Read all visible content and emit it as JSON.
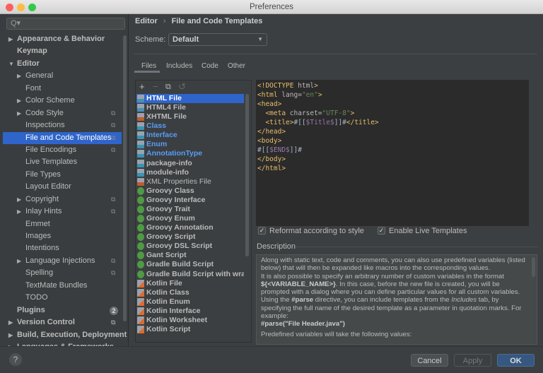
{
  "window": {
    "title": "Preferences"
  },
  "sidebar": {
    "search_placeholder": "Q▾",
    "items": [
      {
        "label": "Appearance & Behavior",
        "level": 0,
        "arrow": "▶",
        "bold": true
      },
      {
        "label": "Keymap",
        "level": 0,
        "bold": true
      },
      {
        "label": "Editor",
        "level": 0,
        "arrow": "▼",
        "bold": true
      },
      {
        "label": "General",
        "level": 1,
        "arrow": "▶"
      },
      {
        "label": "Font",
        "level": 1
      },
      {
        "label": "Color Scheme",
        "level": 1,
        "arrow": "▶"
      },
      {
        "label": "Code Style",
        "level": 1,
        "arrow": "▶",
        "copy": true
      },
      {
        "label": "Inspections",
        "level": 1,
        "copy": true
      },
      {
        "label": "File and Code Templates",
        "level": 1,
        "copy": true,
        "selected": true
      },
      {
        "label": "File Encodings",
        "level": 1,
        "copy": true
      },
      {
        "label": "Live Templates",
        "level": 1
      },
      {
        "label": "File Types",
        "level": 1
      },
      {
        "label": "Layout Editor",
        "level": 1
      },
      {
        "label": "Copyright",
        "level": 1,
        "arrow": "▶",
        "copy": true
      },
      {
        "label": "Inlay Hints",
        "level": 1,
        "arrow": "▶",
        "copy": true
      },
      {
        "label": "Emmet",
        "level": 1
      },
      {
        "label": "Images",
        "level": 1
      },
      {
        "label": "Intentions",
        "level": 1
      },
      {
        "label": "Language Injections",
        "level": 1,
        "arrow": "▶",
        "copy": true
      },
      {
        "label": "Spelling",
        "level": 1,
        "copy": true
      },
      {
        "label": "TextMate Bundles",
        "level": 1
      },
      {
        "label": "TODO",
        "level": 1
      },
      {
        "label": "Plugins",
        "level": 0,
        "bold": true,
        "badge": "2"
      },
      {
        "label": "Version Control",
        "level": 0,
        "arrow": "▶",
        "bold": true,
        "copy": true
      },
      {
        "label": "Build, Execution, Deployment",
        "level": 0,
        "arrow": "▶",
        "bold": true
      },
      {
        "label": "Languages & Frameworks",
        "level": 0,
        "arrow": "▶",
        "bold": true
      }
    ]
  },
  "header": {
    "breadcrumb_parent": "Editor",
    "breadcrumb_sep": "›",
    "breadcrumb_current": "File and Code Templates",
    "scheme_label": "Scheme:",
    "scheme_value": "Default"
  },
  "tabs": [
    {
      "label": "Files",
      "active": true
    },
    {
      "label": "Includes"
    },
    {
      "label": "Code"
    },
    {
      "label": "Other"
    }
  ],
  "toolbar": {
    "add": "+",
    "remove": "−",
    "copy": "⧉",
    "reset": "↺"
  },
  "templates": [
    {
      "label": "HTML File",
      "icon": "html",
      "selected": true
    },
    {
      "label": "HTML4 File",
      "icon": "html"
    },
    {
      "label": "XHTML File",
      "icon": "xhtml"
    },
    {
      "label": "Class",
      "icon": "java",
      "style": "blue"
    },
    {
      "label": "Interface",
      "icon": "java",
      "style": "blue"
    },
    {
      "label": "Enum",
      "icon": "java",
      "style": "blue"
    },
    {
      "label": "AnnotationType",
      "icon": "java",
      "style": "blue"
    },
    {
      "label": "package-info",
      "icon": "java"
    },
    {
      "label": "module-info",
      "icon": "java"
    },
    {
      "label": "XML Properties File",
      "icon": "xml",
      "style": "norm"
    },
    {
      "label": "Groovy Class",
      "icon": "groovy"
    },
    {
      "label": "Groovy Interface",
      "icon": "groovy"
    },
    {
      "label": "Groovy Trait",
      "icon": "groovy"
    },
    {
      "label": "Groovy Enum",
      "icon": "groovy"
    },
    {
      "label": "Groovy Annotation",
      "icon": "groovy"
    },
    {
      "label": "Groovy Script",
      "icon": "groovy"
    },
    {
      "label": "Groovy DSL Script",
      "icon": "groovy"
    },
    {
      "label": "Gant Script",
      "icon": "groovy"
    },
    {
      "label": "Gradle Build Script",
      "icon": "groovy"
    },
    {
      "label": "Gradle Build Script with wrap",
      "icon": "groovy"
    },
    {
      "label": "Kotlin File",
      "icon": "kotlin"
    },
    {
      "label": "Kotlin Class",
      "icon": "kotlin"
    },
    {
      "label": "Kotlin Enum",
      "icon": "kotlin"
    },
    {
      "label": "Kotlin Interface",
      "icon": "kotlin"
    },
    {
      "label": "Kotlin Worksheet",
      "icon": "kotlin"
    },
    {
      "label": "Kotlin Script",
      "icon": "kotlin"
    }
  ],
  "code_lines": [
    [
      [
        "t",
        "<!DOCTYPE "
      ],
      [
        "a",
        "html"
      ],
      [
        "t",
        ">"
      ]
    ],
    [
      [
        "t",
        "<html "
      ],
      [
        "a",
        "lang="
      ],
      [
        "s",
        "\"en\""
      ],
      [
        "t",
        ">"
      ]
    ],
    [
      [
        "t",
        "<head>"
      ]
    ],
    [
      [
        "p",
        "  "
      ],
      [
        "t",
        "<meta "
      ],
      [
        "a",
        "charset="
      ],
      [
        "s",
        "\"UTF-8\""
      ],
      [
        "t",
        ">"
      ]
    ],
    [
      [
        "p",
        "  "
      ],
      [
        "t",
        "<title>"
      ],
      [
        "p",
        "#[["
      ],
      [
        "v",
        "$Title$"
      ],
      [
        "p",
        "]]#"
      ],
      [
        "t",
        "</title>"
      ]
    ],
    [
      [
        "t",
        "</head>"
      ]
    ],
    [
      [
        "t",
        "<body>"
      ]
    ],
    [
      [
        "p",
        "#[["
      ],
      [
        "v",
        "$END$"
      ],
      [
        "p",
        "]]#"
      ]
    ],
    [
      [
        "t",
        "</body>"
      ]
    ],
    [
      [
        "t",
        "</html>"
      ]
    ]
  ],
  "options": {
    "reformat": "Reformat according to style",
    "reformat_checked": true,
    "live": "Enable Live Templates",
    "live_checked": true,
    "check_glyph": "✓"
  },
  "description": {
    "label": "Description",
    "p1": "Along with static text, code and comments, you can also use predefined variables (listed below) that will then be expanded like macros into the corresponding values.",
    "p2a": "It is also possible to specify an arbitrary number of custom variables in the format ",
    "p2b": "${<VARIABLE_NAME>}",
    "p2c": ". In this case, before the new file is created, you will be prompted with a dialog where you can define particular values for all custom variables.",
    "p3a": "Using the ",
    "p3b": "#parse",
    "p3c": " directive, you can include templates from the ",
    "p3d": "Includes",
    "p3e": " tab, by specifying the full name of the desired template as a parameter in quotation marks. For example:",
    "p4": "#parse(\"File Header.java\")",
    "p5": "Predefined variables will take the following values:"
  },
  "buttons": {
    "help": "?",
    "cancel": "Cancel",
    "apply": "Apply",
    "ok": "OK"
  },
  "colors": {
    "selection": "#2f65ca",
    "ok": "#365880",
    "link": "#589df6"
  }
}
